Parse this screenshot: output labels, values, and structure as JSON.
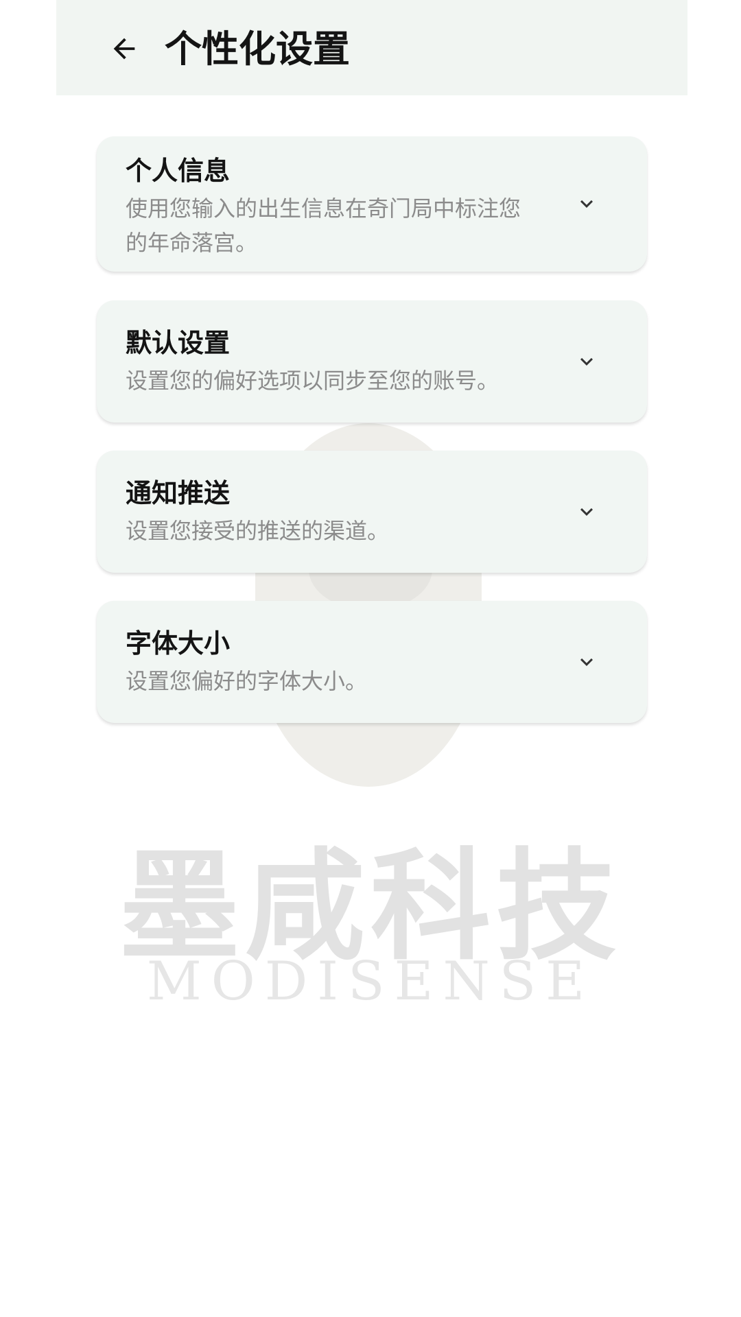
{
  "header": {
    "back_icon": "arrow-left-icon",
    "title": "个性化设置"
  },
  "sections": [
    {
      "title": "个人信息",
      "description": "使用您输入的出生信息在奇门局中标注您的年命落宫。",
      "icon": "chevron-down-icon"
    },
    {
      "title": "默认设置",
      "description": "设置您的偏好选项以同步至您的账号。",
      "icon": "chevron-down-icon"
    },
    {
      "title": "通知推送",
      "description": "设置您接受的推送的渠道。",
      "icon": "chevron-down-icon"
    },
    {
      "title": "字体大小",
      "description": "设置您偏好的字体大小。",
      "icon": "chevron-down-icon"
    }
  ],
  "watermark": {
    "title": "墨咸科技",
    "subtitle": "MODISENSE"
  },
  "colors": {
    "header_bg": "#f1f5f2",
    "card_bg": "#f1f6f3",
    "title_text": "#141414",
    "desc_text": "#8b8b8b"
  }
}
